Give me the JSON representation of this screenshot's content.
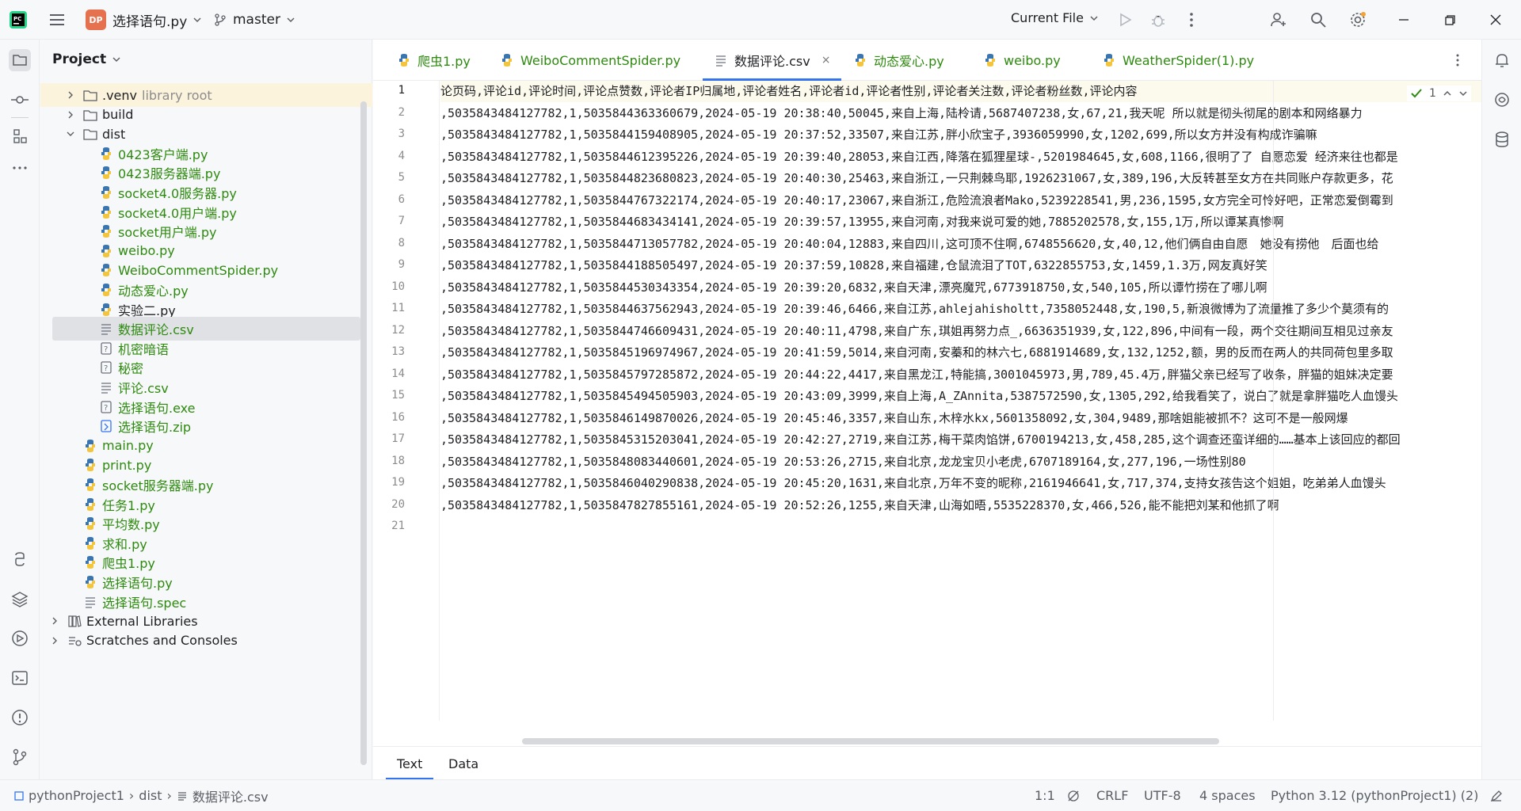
{
  "titlebar": {
    "project_badge": "DP",
    "project_name": "选择语句.py",
    "branch": "master",
    "run_config": "Current File"
  },
  "project_panel": {
    "header": "Project",
    "tree": [
      {
        "label": ".venv",
        "suffix": "library root",
        "type": "folder",
        "arrow": "right",
        "depth": 1
      },
      {
        "label": "build",
        "type": "folder",
        "arrow": "right",
        "depth": 1
      },
      {
        "label": "dist",
        "type": "folder",
        "arrow": "down",
        "depth": 1
      },
      {
        "label": "0423客户端.py",
        "type": "py",
        "depth": 2,
        "green": true
      },
      {
        "label": "0423服务器端.py",
        "type": "py",
        "depth": 2,
        "green": true
      },
      {
        "label": "socket4.0服务器.py",
        "type": "py",
        "depth": 2,
        "green": true
      },
      {
        "label": "socket4.0用户端.py",
        "type": "py",
        "depth": 2,
        "green": true
      },
      {
        "label": "socket用户端.py",
        "type": "py",
        "depth": 2,
        "green": true
      },
      {
        "label": "weibo.py",
        "type": "py",
        "depth": 2,
        "green": true
      },
      {
        "label": "WeiboCommentSpider.py",
        "type": "py",
        "depth": 2,
        "green": true
      },
      {
        "label": "动态爱心.py",
        "type": "py",
        "depth": 2,
        "green": true
      },
      {
        "label": "实验二.py",
        "type": "py",
        "depth": 2,
        "green": false
      },
      {
        "label": "数据评论.csv",
        "type": "text",
        "depth": 2,
        "green": true,
        "selected": true
      },
      {
        "label": "机密暗语",
        "type": "unknown",
        "depth": 2,
        "green": true
      },
      {
        "label": "秘密",
        "type": "unknown",
        "depth": 2,
        "green": true
      },
      {
        "label": "评论.csv",
        "type": "text",
        "depth": 2,
        "green": true
      },
      {
        "label": "选择语句.exe",
        "type": "unknown",
        "depth": 2,
        "green": true
      },
      {
        "label": "选择语句.zip",
        "type": "zip",
        "depth": 2,
        "green": true
      },
      {
        "label": "main.py",
        "type": "py",
        "depth": 1,
        "green": true
      },
      {
        "label": "print.py",
        "type": "py",
        "depth": 1,
        "green": true
      },
      {
        "label": "socket服务器端.py",
        "type": "py",
        "depth": 1,
        "green": true
      },
      {
        "label": "任务1.py",
        "type": "py",
        "depth": 1,
        "green": true
      },
      {
        "label": "平均数.py",
        "type": "py",
        "depth": 1,
        "green": true
      },
      {
        "label": "求和.py",
        "type": "py",
        "depth": 1,
        "green": true
      },
      {
        "label": "爬虫1.py",
        "type": "py",
        "depth": 1,
        "green": true
      },
      {
        "label": "选择语句.py",
        "type": "py",
        "depth": 1,
        "green": true
      },
      {
        "label": "选择语句.spec",
        "type": "text",
        "depth": 1,
        "green": true
      },
      {
        "label": "External Libraries",
        "type": "lib",
        "arrow": "right",
        "depth": 0,
        "green": false
      },
      {
        "label": "Scratches and Consoles",
        "type": "scratch",
        "arrow": "right",
        "depth": 0,
        "green": false
      }
    ]
  },
  "tabs": [
    {
      "label": "爬虫1.py",
      "type": "py"
    },
    {
      "label": "WeiboCommentSpider.py",
      "type": "py"
    },
    {
      "label": "数据评论.csv",
      "type": "text",
      "active": true,
      "close": "×"
    },
    {
      "label": "动态爱心.py",
      "type": "py"
    },
    {
      "label": "weibo.py",
      "type": "py"
    },
    {
      "label": "WeatherSpider(1).py",
      "type": "py"
    }
  ],
  "editor": {
    "inspection": "1",
    "lines": [
      "论页码,评论id,评论时间,评论点赞数,评论者IP归属地,评论者姓名,评论者id,评论者性别,评论者关注数,评论者粉丝数,评论内容",
      ",5035843484127782,1,5035844363360679,2024-05-19 20:38:40,50045,来自上海,陆柃请,5687407238,女,67,21,我天呢 所以就是彻头彻尾的剧本和网络暴力",
      ",5035843484127782,1,5035844159408905,2024-05-19 20:37:52,33507,来自江苏,胖小欣宝子,3936059990,女,1202,699,所以女方并没有构成诈骗嘛",
      ",5035843484127782,1,5035844612395226,2024-05-19 20:39:40,28053,来自江西,降落在狐狸星球-,5201984645,女,608,1166,很明了了 自愿恋爱 经济来往也都是",
      ",5035843484127782,1,5035844823680823,2024-05-19 20:40:30,25463,来自浙江,一只荆棘鸟耶,1926231067,女,389,196,大反转甚至女方在共同账户存款更多，花",
      ",5035843484127782,1,5035844767322174,2024-05-19 20:40:17,23067,来自浙江,危险流浪者Mako,5239228541,男,236,1595,女方完全可怜好吧，正常恋爱倒霉到",
      ",5035843484127782,1,5035844683434141,2024-05-19 20:39:57,13955,来自河南,对我来说可爱的她,7885202578,女,155,1万,所以谭某真惨啊",
      ",5035843484127782,1,5035844713057782,2024-05-19 20:40:04,12883,来自四川,这可顶不住啊,6748556620,女,40,12,他们俩自由自愿　她没有捞他　后面也给",
      ",5035843484127782,1,5035844188505497,2024-05-19 20:37:59,10828,来自福建,仓鼠流泪了TOT,6322855753,女,1459,1.3万,网友真好笑",
      ",5035843484127782,1,5035844530343354,2024-05-19 20:39:20,6832,来自天津,漂亮魔咒,6773918750,女,540,105,所以谭竹捞在了哪儿啊",
      ",5035843484127782,1,5035844637562943,2024-05-19 20:39:46,6466,来自江苏,ahlejahisholtt,7358052448,女,190,5,新浪微博为了流量推了多少个莫须有的",
      ",5035843484127782,1,5035844746609431,2024-05-19 20:40:11,4798,来自广东,琪姐再努力点_,6636351939,女,122,896,中间有一段，两个交往期间互相见过亲友",
      ",5035843484127782,1,5035845196974967,2024-05-19 20:41:59,5014,来自河南,安蓁和的林六七,6881914689,女,132,1252,额，男的反而在两人的共同荷包里多取",
      ",5035843484127782,1,5035845797285872,2024-05-19 20:44:22,4417,来自黑龙江,特能搞,3001045973,男,789,45.4万,胖猫父亲已经写了收条，胖猫的姐妹决定要",
      ",5035843484127782,1,5035845494505903,2024-05-19 20:43:09,3999,来自上海,A_ZAnnita,5387572590,女,1305,292,给我看笑了，说白了就是拿胖猫吃人血馒头",
      ",5035843484127782,1,5035846149870026,2024-05-19 20:45:46,3357,来自山东,木梓水kx,5601358092,女,304,9489,那啥姐能被抓不？这可不是一般网爆",
      ",5035843484127782,1,5035845315203041,2024-05-19 20:42:27,2719,来自江苏,梅干菜肉馅饼,6700194213,女,458,285,这个调查还蛮详细的……基本上该回应的都回",
      ",5035843484127782,1,5035848083440601,2024-05-19 20:53:26,2715,来自北京,龙龙宝贝小老虎,6707189164,女,277,196,一场性别80",
      ",5035843484127782,1,5035846040290838,2024-05-19 20:45:20,1631,来自北京,万年不变的昵称,2161946641,女,717,374,支持女孩告这个姐姐，吃弟弟人血馒头",
      ",5035843484127782,1,5035847827855161,2024-05-19 20:52:26,1255,来自天津,山海如晤,5535228370,女,466,526,能不能把刘某和他抓了啊",
      ""
    ]
  },
  "bottom_tabs": {
    "text": "Text",
    "data": "Data"
  },
  "statusbar": {
    "breadcrumb": [
      "pythonProject1",
      "dist",
      "数据评论.csv"
    ],
    "position": "1:1",
    "line_sep": "CRLF",
    "encoding": "UTF-8",
    "indent": "4 spaces",
    "interpreter": "Python 3.12 (pythonProject1) (2)"
  },
  "colors": {
    "accent": "#3574f0",
    "vcs_green": "#2e8a0f",
    "project_badge": "#e5714f"
  }
}
